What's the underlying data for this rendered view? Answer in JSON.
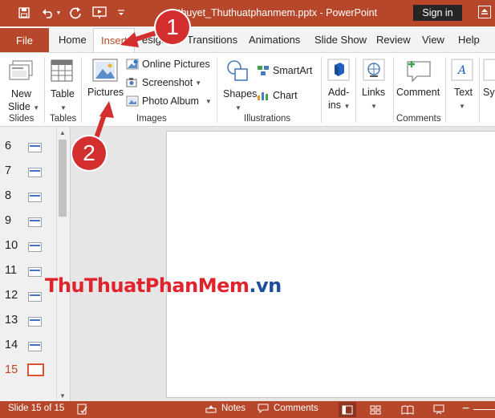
{
  "colors": {
    "accent": "#b7472a",
    "active_thumb": "#d9552f",
    "callout": "#d32f2f",
    "watermark_main": "#e0242c",
    "watermark_tld": "#1d4f9a"
  },
  "titlebar": {
    "quick_access": [
      "save-icon",
      "undo-icon",
      "redo-icon",
      "present-icon",
      "customize-icon"
    ],
    "title": "thuyet_Thuthuatphanmem.pptx - PowerPoint",
    "signin": "Sign in"
  },
  "tabs": {
    "file": "File",
    "home": "Home",
    "insert": "Insert",
    "design_partial": "esign",
    "transitions": "Transitions",
    "animations": "Animations",
    "slideshow": "Slide Show",
    "review": "Review",
    "view": "View",
    "help": "Help"
  },
  "ribbon": {
    "slides": {
      "new_slide_line1": "New",
      "new_slide_line2": "Slide",
      "label": "Slides"
    },
    "tables": {
      "table": "Table",
      "label": "Tables"
    },
    "images": {
      "pictures": "Pictures",
      "online_pictures": "Online Pictures",
      "screenshot": "Screenshot",
      "photo_album": "Photo Album",
      "label": "Images"
    },
    "illustrations": {
      "shapes": "Shapes",
      "smartart": "SmartArt",
      "chart": "Chart",
      "label": "Illustrations"
    },
    "addins": {
      "line1": "Add-",
      "line2": "ins"
    },
    "links": {
      "label": "Links"
    },
    "comments": {
      "comment": "Comment",
      "label": "Comments"
    },
    "text": {
      "label": "Text"
    },
    "symbols_partial": "Sy"
  },
  "thumbnails": [
    {
      "num": "6"
    },
    {
      "num": "7"
    },
    {
      "num": "8"
    },
    {
      "num": "9"
    },
    {
      "num": "10"
    },
    {
      "num": "11"
    },
    {
      "num": "12"
    },
    {
      "num": "13"
    },
    {
      "num": "14"
    },
    {
      "num": "15",
      "active": true
    }
  ],
  "watermark": {
    "main": "ThuThuatPhanMem",
    "tld": ".vn"
  },
  "statusbar": {
    "slide_info": "Slide 15 of 15",
    "notes": "Notes",
    "comments": "Comments"
  },
  "annotations": {
    "step1": "1",
    "step2": "2"
  }
}
